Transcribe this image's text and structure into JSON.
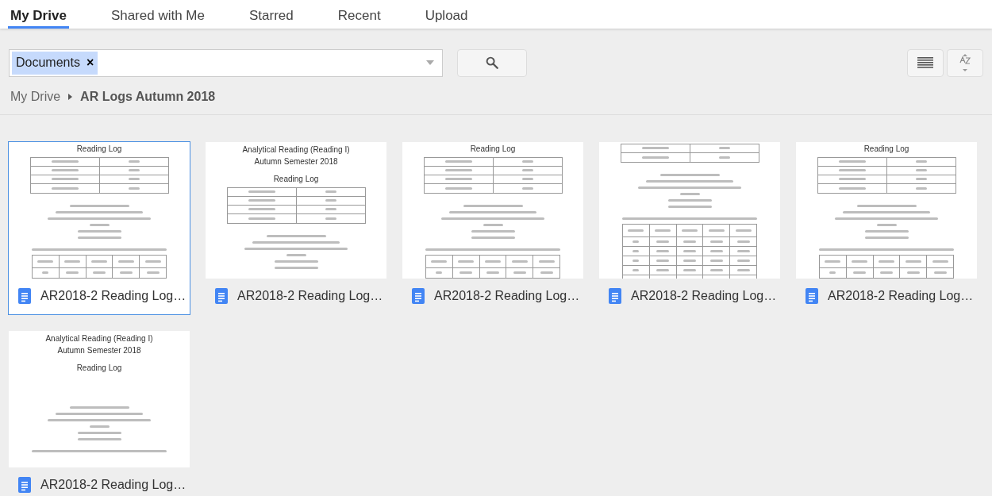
{
  "tabs": [
    {
      "label": "My Drive",
      "selected": true
    },
    {
      "label": "Shared with Me",
      "selected": false
    },
    {
      "label": "Starred",
      "selected": false
    },
    {
      "label": "Recent",
      "selected": false
    },
    {
      "label": "Upload",
      "selected": false
    }
  ],
  "search": {
    "chips": [
      {
        "label": "Documents",
        "remove": "×"
      }
    ]
  },
  "breadcrumb": [
    "My Drive",
    "AR Logs Autumn 2018"
  ],
  "files": [
    {
      "name": "AR2018-2 Reading Log…",
      "selected": true,
      "page": [
        {
          "kind": "heading",
          "lines": [
            "Reading Log"
          ]
        },
        {
          "kind": "roster",
          "rows": [
            {
              "kind": "blurred"
            },
            {
              "kind": "blurred"
            },
            {
              "kind": "blurred"
            },
            {
              "kind": "blurred"
            }
          ]
        },
        {
          "kind": "instructions"
        },
        {
          "kind": "note"
        },
        {
          "kind": "roles",
          "rows": [
            {
              "kind": "blurred"
            }
          ]
        }
      ]
    },
    {
      "name": "AR2018-2 Reading Log…",
      "selected": false,
      "page": [
        {
          "kind": "title",
          "lines": [
            "Analytical Reading (Reading I)",
            "Autumn Semester 2018"
          ]
        },
        {
          "kind": "heading",
          "lines": [
            "Reading Log"
          ]
        },
        {
          "kind": "roster",
          "rows": [
            {
              "kind": "blurred"
            },
            {
              "kind": "blurred"
            },
            {
              "kind": "blurred"
            },
            {
              "kind": "blurred"
            }
          ]
        },
        {
          "kind": "instructions"
        }
      ]
    },
    {
      "name": "AR2018-2 Reading Log…",
      "selected": false,
      "page": [
        {
          "kind": "heading",
          "lines": [
            "Reading Log"
          ]
        },
        {
          "kind": "roster",
          "rows": [
            {
              "kind": "blurred"
            },
            {
              "kind": "blurred"
            },
            {
              "kind": "blurred"
            },
            {
              "kind": "blurred"
            }
          ]
        },
        {
          "kind": "instructions"
        },
        {
          "kind": "note"
        },
        {
          "kind": "roles",
          "rows": [
            {
              "kind": "blurred"
            }
          ]
        }
      ]
    },
    {
      "name": "AR2018-2 Reading Log…",
      "selected": false,
      "page": [
        {
          "kind": "roster",
          "rows": [
            {
              "kind": "blurred"
            },
            {
              "kind": "blurred"
            }
          ]
        },
        {
          "kind": "instructions"
        },
        {
          "kind": "note"
        },
        {
          "kind": "roles",
          "rows": [
            {
              "kind": "blurred"
            },
            {
              "kind": "blurred"
            },
            {
              "kind": "blurred"
            },
            {
              "kind": "blurred"
            },
            {
              "kind": "blurred"
            }
          ]
        }
      ]
    },
    {
      "name": "AR2018-2 Reading Log…",
      "selected": false,
      "page": [
        {
          "kind": "heading",
          "lines": [
            "Reading Log"
          ]
        },
        {
          "kind": "roster",
          "rows": [
            {
              "kind": "blurred"
            },
            {
              "kind": "blurred"
            },
            {
              "kind": "blurred"
            },
            {
              "kind": "blurred"
            }
          ]
        },
        {
          "kind": "instructions"
        },
        {
          "kind": "note"
        },
        {
          "kind": "roles",
          "rows": [
            {
              "kind": "blurred"
            }
          ]
        }
      ]
    },
    {
      "name": "AR2018-2 Reading Log…",
      "selected": false,
      "page": [
        {
          "kind": "title",
          "lines": [
            "Analytical Reading (Reading I)",
            "Autumn Semester 2018"
          ]
        },
        {
          "kind": "heading",
          "lines": [
            "Reading Log"
          ]
        },
        {
          "kind": "spacer"
        },
        {
          "kind": "instructions"
        },
        {
          "kind": "note"
        }
      ]
    }
  ]
}
